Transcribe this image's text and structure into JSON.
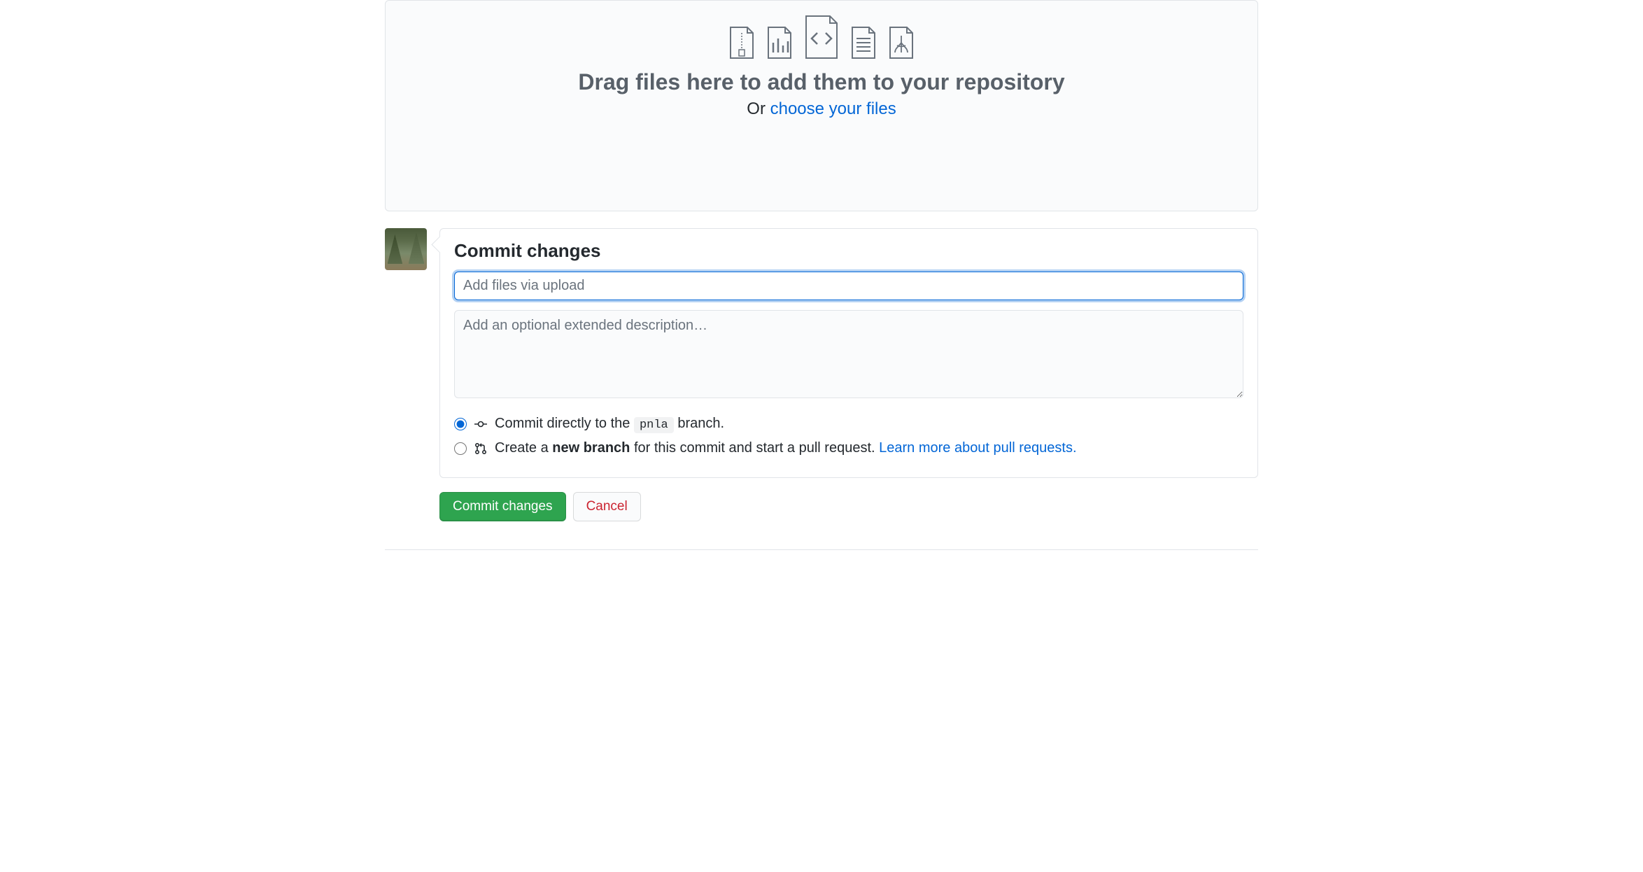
{
  "dropzone": {
    "heading": "Drag files here to add them to your repository",
    "or": "Or ",
    "choose_link": "choose your files"
  },
  "commit": {
    "title": "Commit changes",
    "message_placeholder": "Add files via upload",
    "description_placeholder": "Add an optional extended description…",
    "direct": {
      "prefix": "Commit directly to the ",
      "branch": "pnla",
      "suffix": " branch."
    },
    "newbranch": {
      "prefix": "Create a ",
      "bold": "new branch",
      "mid": " for this commit and start a pull request. ",
      "link": "Learn more about pull requests."
    }
  },
  "actions": {
    "commit": "Commit changes",
    "cancel": "Cancel"
  }
}
